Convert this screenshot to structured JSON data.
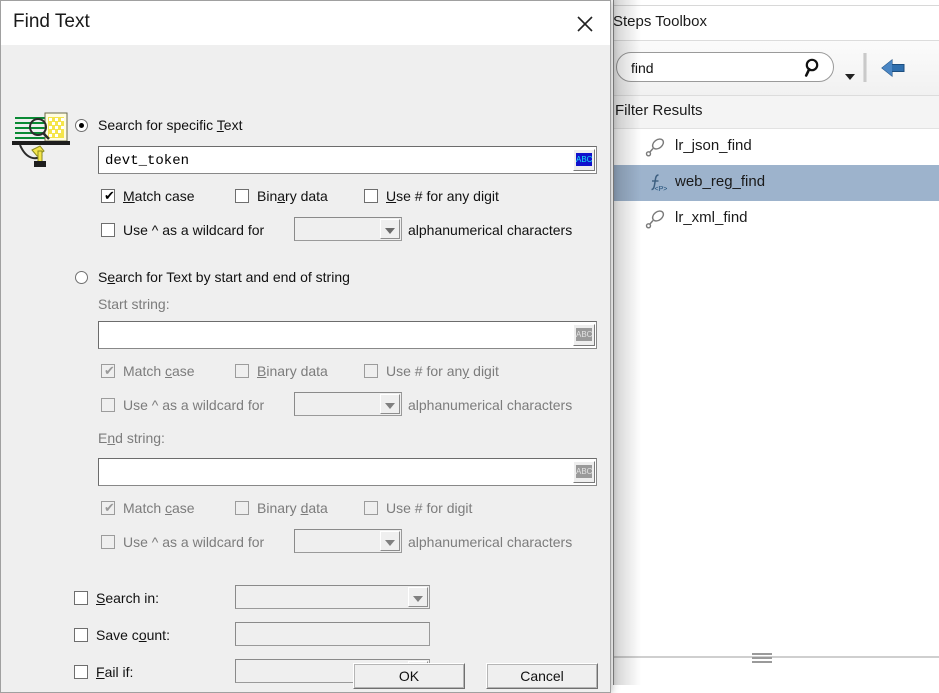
{
  "dialog": {
    "title": "Find Text",
    "close_icon": "close-icon",
    "find_icon": "find-text-icon",
    "section1": {
      "radio_label": "Search for specific Text",
      "radio_selected": true,
      "text_value": "devt_token",
      "abc_button": "ABC",
      "checkboxes": [
        {
          "label": "Match case",
          "checked": true,
          "enabled": true
        },
        {
          "label": "Binary data",
          "checked": false,
          "enabled": true
        },
        {
          "label": "Use # for any digit",
          "checked": false,
          "enabled": true
        }
      ],
      "wildcard": {
        "label": "Use ^ as a wildcard for",
        "checked": false,
        "enabled": true,
        "combo_value": "",
        "suffix": "alphanumerical characters"
      }
    },
    "section2": {
      "radio_label": "Search for Text by start and end of string",
      "radio_selected": false,
      "start_label": "Start string:",
      "start_value": "",
      "start_abc": "ABC",
      "start_checkboxes": [
        {
          "label": "Match case",
          "checked": true,
          "enabled": false
        },
        {
          "label": "Binary data",
          "checked": false,
          "enabled": false
        },
        {
          "label": "Use # for any digit",
          "checked": false,
          "enabled": false
        }
      ],
      "start_wildcard": {
        "label": "Use ^ as a wildcard for",
        "checked": false,
        "enabled": false,
        "combo_value": "",
        "suffix": "alphanumerical characters"
      },
      "end_label": "End string:",
      "end_value": "",
      "end_abc": "ABC",
      "end_checkboxes": [
        {
          "label": "Match case",
          "checked": true,
          "enabled": false
        },
        {
          "label": "Binary data",
          "checked": false,
          "enabled": false
        },
        {
          "label": "Use # for any digit",
          "checked": false,
          "enabled": false
        }
      ],
      "end_wildcard": {
        "label": "Use ^ as a wildcard for",
        "checked": false,
        "enabled": false,
        "combo_value": "",
        "suffix": "alphanumerical characters"
      }
    },
    "options": [
      {
        "label": "Search in:",
        "checked": false,
        "type": "combo",
        "value": ""
      },
      {
        "label": "Save count:",
        "checked": false,
        "type": "text",
        "value": ""
      },
      {
        "label": "Fail if:",
        "checked": false,
        "type": "combo",
        "value": ""
      }
    ],
    "buttons": {
      "ok": "OK",
      "cancel": "Cancel"
    }
  },
  "toolbox": {
    "title": "Steps Toolbox",
    "search": {
      "value": "find",
      "placeholder": "",
      "icon": "search-icon"
    },
    "dropdown_icon": "chevron-down-icon",
    "back_icon": "back-arrow-icon",
    "filter_header": "Filter Results",
    "results": [
      {
        "label": "lr_json_find",
        "icon": "step-icon",
        "selected": false
      },
      {
        "label": "web_reg_find",
        "icon": "step-function-icon",
        "selected": true
      },
      {
        "label": "lr_xml_find",
        "icon": "step-icon",
        "selected": false
      }
    ]
  },
  "colors": {
    "dialog_bg": "#efefef",
    "selection_blue": "#9db3cc",
    "accent_blue": "#1f5fa9",
    "abc_blue": "#1111cc"
  }
}
